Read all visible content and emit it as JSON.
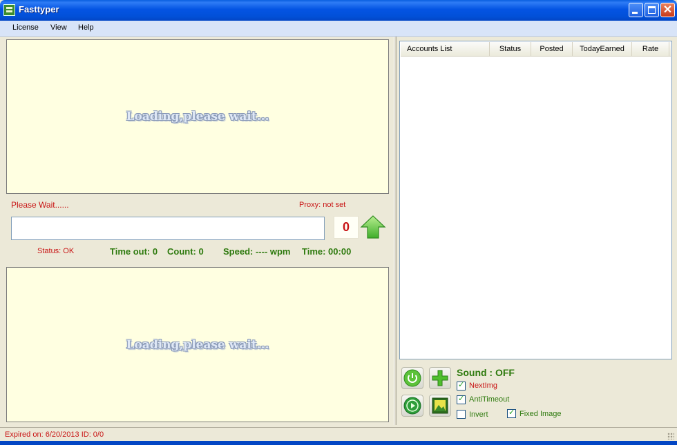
{
  "window": {
    "title": "Fasttyper"
  },
  "menu": {
    "items": [
      "License",
      "View",
      "Help"
    ]
  },
  "captcha": {
    "top_loading": "Loading,please wait...",
    "bottom_loading": "Loading,please wait...",
    "wait_message": "Please Wait......",
    "proxy": "Proxy: not set",
    "input_value": "",
    "counter": "0"
  },
  "stats": {
    "status": "Status: OK",
    "timeout": "Time out: 0",
    "count": "Count: 0",
    "speed": "Speed: ---- wpm",
    "time": "Time: 00:00"
  },
  "accounts": {
    "columns": [
      "Accounts List",
      "Status",
      "Posted",
      "TodayEarned",
      "Rate"
    ],
    "rows": []
  },
  "controls": {
    "sound": "Sound : OFF",
    "options": [
      {
        "label": "NextImg",
        "checked": true,
        "color": "#c81414"
      },
      {
        "label": "AntiTimeout",
        "checked": true,
        "color": "#2e7a0e"
      },
      {
        "label": "Invert",
        "checked": false,
        "color": "#2e7a0e"
      },
      {
        "label": "Fixed Image",
        "checked": true,
        "color": "#2e7a0e"
      }
    ],
    "icons": [
      "power-icon",
      "add-icon",
      "play-icon",
      "picture-icon"
    ]
  },
  "statusbar": {
    "text": "Expired on: 6/20/2013  ID: 0/0"
  },
  "colors": {
    "accent_red": "#c81414",
    "accent_green": "#2e7a0e",
    "panel_bg": "#ffffe1",
    "titlebar": "#0454e3"
  }
}
